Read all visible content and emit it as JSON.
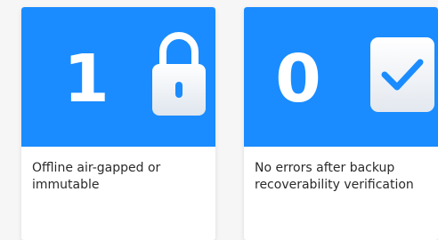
{
  "cards": [
    {
      "number": "1",
      "text": "Offline air-gapped or immutable",
      "icon": "lock-icon"
    },
    {
      "number": "0",
      "text": "No errors after backup recoverability verification",
      "icon": "checkmark-icon"
    }
  ],
  "colors": {
    "accent": "#1a8cff",
    "icon_check": "#1a8cff",
    "card_bg": "#ffffff",
    "page_bg": "#f6f6f6"
  }
}
